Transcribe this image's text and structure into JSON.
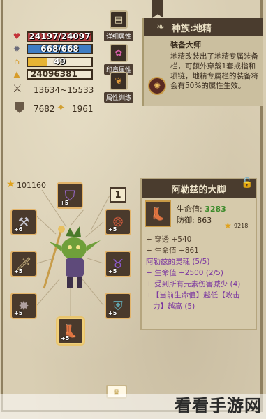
{
  "stats": {
    "hp": "24197/24097",
    "mana": "668/668",
    "gold_bar": "49",
    "exp": "24096381",
    "attack": "13634~15533",
    "armor": "7682",
    "special": "1961"
  },
  "side_buttons": [
    {
      "label": "详细属性",
      "icon": "scroll-icon"
    },
    {
      "label": "印章属性",
      "icon": "flower-seal-icon"
    },
    {
      "label": "属性训练",
      "icon": "book-icon"
    }
  ],
  "race": {
    "title": "种族:地精",
    "subtitle": "装备大师",
    "desc": "地精改装出了地精专属装备栏，可额外穿戴1套戒指和项链，地精专属栏的装备将会有50%的属性生效。"
  },
  "equipment": {
    "power": "101160",
    "page_number": "1",
    "slots": [
      {
        "name": "helmet",
        "level": "+5"
      },
      {
        "name": "weapon-left",
        "level": "+6"
      },
      {
        "name": "shoulder",
        "level": "+5"
      },
      {
        "name": "ring",
        "level": "+5"
      },
      {
        "name": "gauntlet",
        "level": "+5"
      },
      {
        "name": "belt",
        "level": "+5"
      },
      {
        "name": "bracer",
        "level": "+5"
      },
      {
        "name": "boots",
        "level": "+5"
      }
    ]
  },
  "item": {
    "title": "阿勒兹的大脚",
    "hp_label": "生命值:",
    "hp_value": "3283",
    "def_label": "防御:",
    "def_value": "863",
    "score": "9218",
    "lines": [
      {
        "text": "+ 穿透 +540",
        "style": "normal"
      },
      {
        "text": "+ 生命值 +861",
        "style": "normal"
      },
      {
        "text": "阿勒兹的灵魂 (5/5)",
        "style": "purple"
      },
      {
        "text": "+ 生命值 +2500 (2/5)",
        "style": "purple"
      },
      {
        "text": "+ 受到所有元素伤害减少 (4)",
        "style": "purple"
      },
      {
        "text": "+【当前生命值】越低【攻击",
        "style": "purple"
      },
      {
        "text": "力】越高 (5)",
        "style": "purple"
      }
    ]
  },
  "watermark": "看看手游网"
}
